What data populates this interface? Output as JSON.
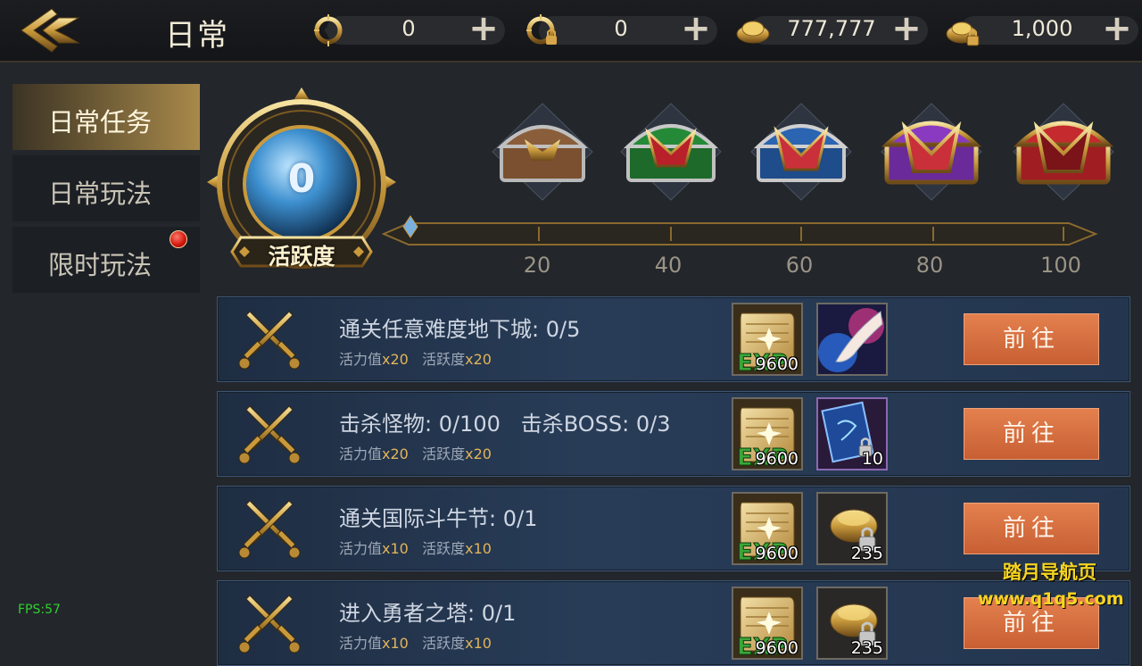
{
  "header": {
    "title": "日常"
  },
  "currencies": [
    {
      "icon": "gold-c-coin-icon",
      "value": "0"
    },
    {
      "icon": "locked-c-coin-icon",
      "value": "0"
    },
    {
      "icon": "gold-ingot-icon",
      "value": "777,777"
    },
    {
      "icon": "locked-gold-ingot-icon",
      "value": "1,000"
    }
  ],
  "sidebar": {
    "items": [
      {
        "label": "日常任务",
        "active": true,
        "badge": false
      },
      {
        "label": "日常玩法",
        "active": false,
        "badge": false
      },
      {
        "label": "限时玩法",
        "active": false,
        "badge": true
      }
    ]
  },
  "activity": {
    "value": "0",
    "label": "活跃度",
    "progress": 0,
    "milestones": [
      "20",
      "40",
      "60",
      "80",
      "100"
    ]
  },
  "tasks": [
    {
      "title": "通关任意难度地下城: 0/5",
      "sub1": "活力值",
      "mult1": "x20",
      "sub2": "活跃度",
      "mult2": "x20",
      "rewards": [
        {
          "icon": "exp-scroll-icon",
          "count": "9600"
        },
        {
          "icon": "skill-hand-icon",
          "count": ""
        }
      ],
      "button": "前往"
    },
    {
      "title": "击杀怪物: 0/100   击杀BOSS: 0/3",
      "sub1": "活力值",
      "mult1": "x20",
      "sub2": "活跃度",
      "mult2": "x20",
      "rewards": [
        {
          "icon": "exp-scroll-icon",
          "count": "9600"
        },
        {
          "icon": "blue-spellbook-icon",
          "count": "10"
        }
      ],
      "button": "前往"
    },
    {
      "title": "通关国际斗牛节: 0/1",
      "sub1": "活力值",
      "mult1": "x10",
      "sub2": "活跃度",
      "mult2": "x10",
      "rewards": [
        {
          "icon": "exp-scroll-icon",
          "count": "9600"
        },
        {
          "icon": "locked-gold-ingot-icon",
          "count": "235"
        }
      ],
      "button": "前往"
    },
    {
      "title": "进入勇者之塔: 0/1",
      "sub1": "活力值",
      "mult1": "x10",
      "sub2": "活跃度",
      "mult2": "x10",
      "rewards": [
        {
          "icon": "exp-scroll-icon",
          "count": "9600"
        },
        {
          "icon": "locked-gold-ingot-icon",
          "count": "235"
        }
      ],
      "button": "前往"
    }
  ],
  "fps": "FPS:57",
  "watermark": {
    "line1": "踏月导航页",
    "line2": "www.q1q5.com"
  },
  "colors": {
    "accent_gold": "#a8894a",
    "button_orange": "#d86c3c",
    "task_blue": "#283c57"
  }
}
